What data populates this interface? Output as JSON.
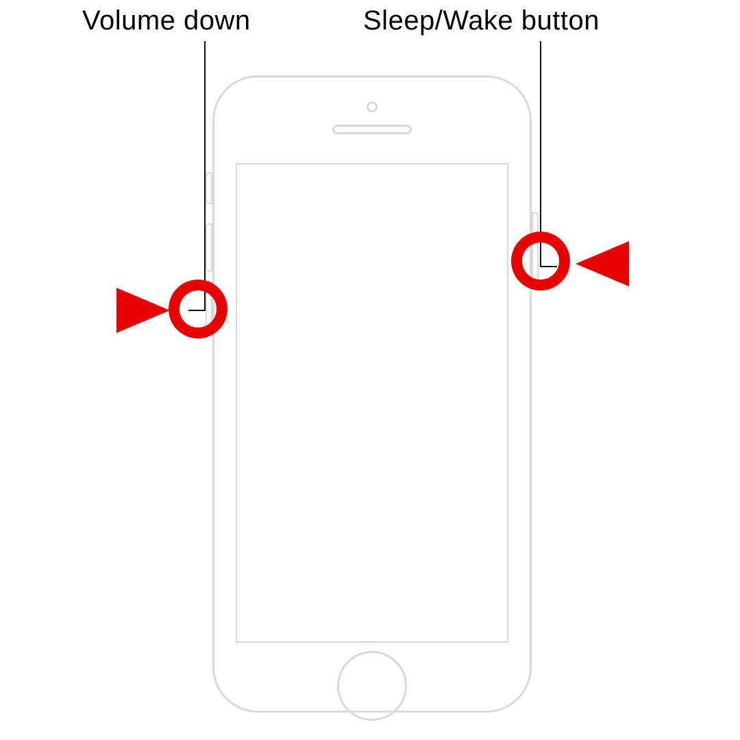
{
  "labels": {
    "volume_down": "Volume down",
    "sleep_wake": "Sleep/Wake button"
  },
  "callouts": {
    "left_button_name": "volume-down-button",
    "right_button_name": "sleep-wake-button"
  },
  "colors": {
    "highlight": "#e60000",
    "outline": "#d9d9d9",
    "text": "#000000"
  }
}
